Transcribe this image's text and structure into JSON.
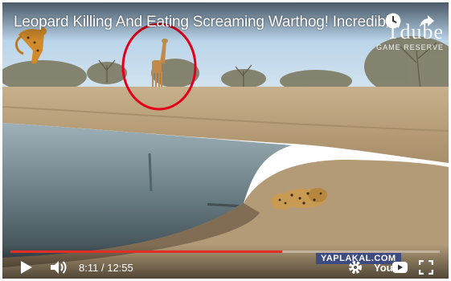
{
  "video": {
    "title": "Leopard Killing And Eating Screaming Warthog! Incredibl...",
    "current_time": "8:11",
    "separator": "/",
    "duration": "12:55",
    "progress_fraction": 0.6336
  },
  "logo": {
    "brand": "Tdube",
    "subtitle": "GAME RESERVE"
  },
  "watermark": "YAPLAKAL.COM",
  "icons": {
    "top": [
      "clock-icon",
      "share-icon"
    ],
    "controls": [
      "play-icon",
      "volume-icon",
      "settings-gear-icon",
      "youtube-logo-icon",
      "fullscreen-icon"
    ]
  },
  "colors": {
    "progress": "#e52d27",
    "annotation": "#e3001b"
  },
  "youtube_logo_text": "You"
}
